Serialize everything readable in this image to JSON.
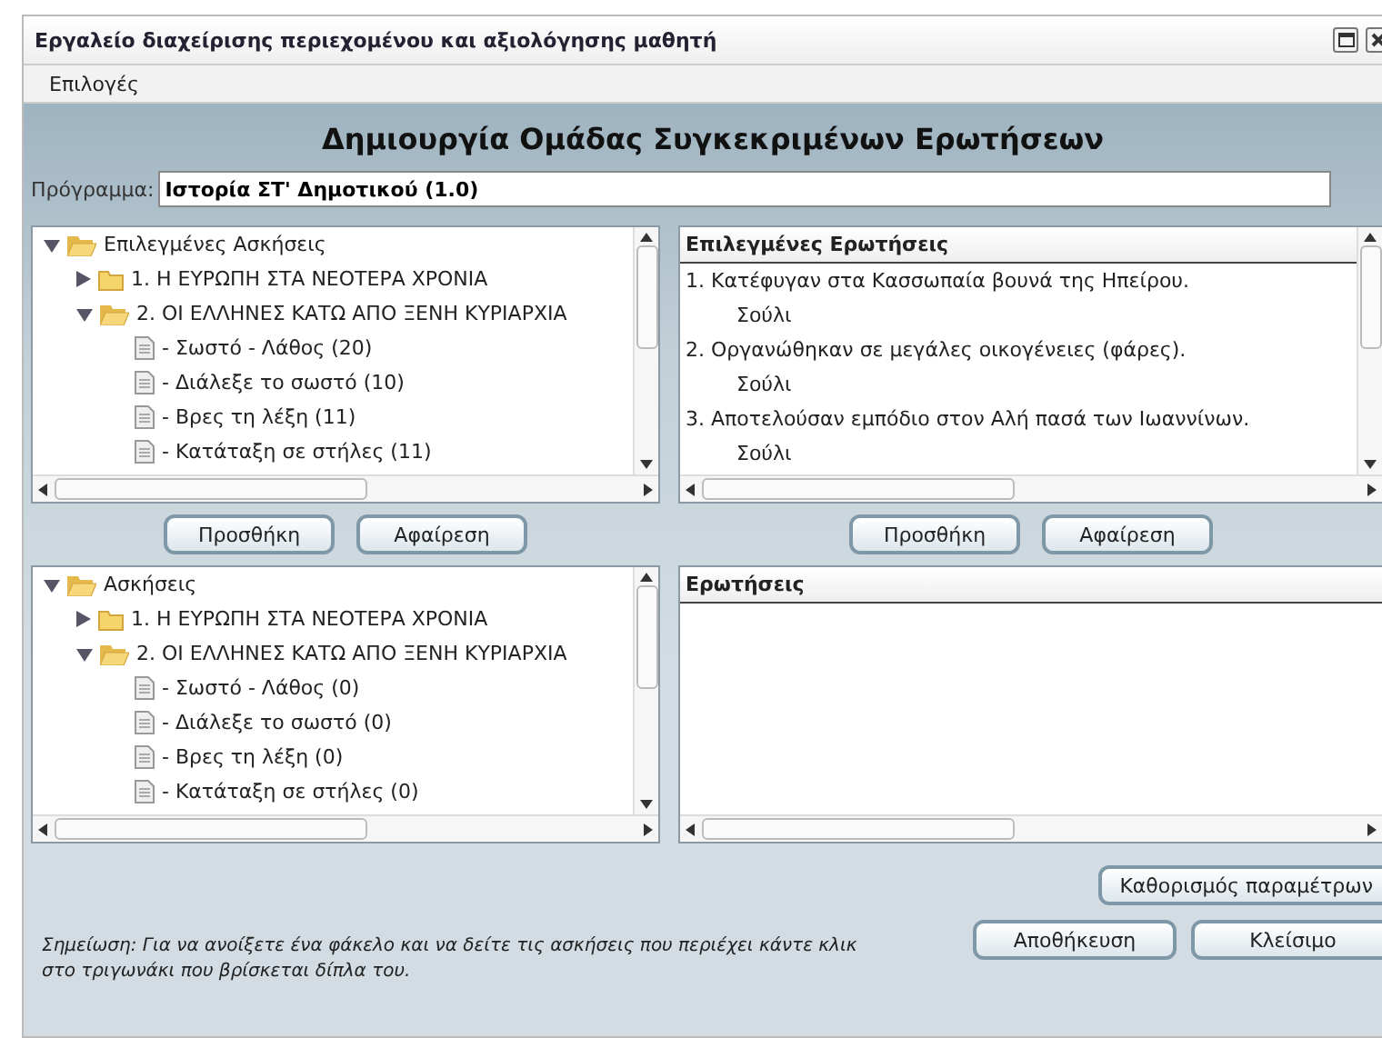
{
  "window": {
    "title": "Εργαλείο διαχείρισης περιεχομένου και αξιολόγησης μαθητή"
  },
  "menu": [
    "Επιλογές"
  ],
  "heading": "Δημιουργία Ομάδας Συγκεκριμένων Ερωτήσεων",
  "program": {
    "label": "Πρόγραμμα:",
    "value": "Ιστορία ΣΤ' Δημοτικού (1.0)"
  },
  "selected_exercises": {
    "tree": [
      {
        "label": "Επιλεγμένες Ασκήσεις",
        "kind": "folder",
        "expanded": true,
        "children": [
          {
            "label": "1.  Η ΕΥΡΩΠΗ ΣΤΑ ΝΕΟΤΕΡΑ ΧΡΟΝΙΑ",
            "kind": "folder",
            "expanded": false
          },
          {
            "label": "2.  ΟΙ ΕΛΛΗΝΕΣ ΚΑΤΩ ΑΠΟ ΞΕΝΗ ΚΥΡΙΑΡΧΙΑ",
            "kind": "folder",
            "expanded": true,
            "children": [
              {
                "label": "- Σωστό - Λάθος  (20)",
                "kind": "file"
              },
              {
                "label": "- Διάλεξε το σωστό  (10)",
                "kind": "file"
              },
              {
                "label": "- Βρες τη λέξη  (11)",
                "kind": "file"
              },
              {
                "label": "- Κατάταξη σε στήλες  (11)",
                "kind": "file"
              }
            ]
          }
        ]
      }
    ],
    "buttons": [
      "Προσθήκη",
      "Αφαίρεση"
    ]
  },
  "selected_questions": {
    "header": "Επιλεγμένες Ερωτήσεις",
    "items": [
      {
        "question": "1. Κατέφυγαν στα Κασσωπαία βουνά της Ηπείρου.",
        "answer": "Σούλι"
      },
      {
        "question": "2. Οργανώθηκαν σε μεγάλες οικογένειες (φάρες).",
        "answer": "Σούλι"
      },
      {
        "question": "3. Αποτελούσαν εμπόδιο στον Αλή πασά των Ιωαννίνων.",
        "answer": "Σούλι"
      }
    ],
    "buttons": [
      "Προσθήκη",
      "Αφαίρεση"
    ]
  },
  "exercises": {
    "tree": [
      {
        "label": "Ασκήσεις",
        "kind": "folder",
        "expanded": true,
        "children": [
          {
            "label": "1.  Η ΕΥΡΩΠΗ ΣΤΑ ΝΕΟΤΕΡΑ ΧΡΟΝΙΑ",
            "kind": "folder",
            "expanded": false
          },
          {
            "label": "2.  ΟΙ ΕΛΛΗΝΕΣ ΚΑΤΩ ΑΠΟ ΞΕΝΗ ΚΥΡΙΑΡΧΙΑ",
            "kind": "folder",
            "expanded": true,
            "children": [
              {
                "label": "- Σωστό - Λάθος  (0)",
                "kind": "file"
              },
              {
                "label": "- Διάλεξε το σωστό  (0)",
                "kind": "file"
              },
              {
                "label": "- Βρες τη λέξη  (0)",
                "kind": "file"
              },
              {
                "label": "- Κατάταξη σε στήλες  (0)",
                "kind": "file"
              }
            ]
          }
        ]
      }
    ]
  },
  "questions": {
    "header": "Ερωτήσεις"
  },
  "parameters_button": "Καθορισμός παραμέτρων",
  "note": "Σημείωση: Για να ανοίξετε ένα φάκελο και να δείτε τις ασκήσεις που περιέχει κάντε κλικ στο τριγωνάκι που βρίσκεται δίπλα του.",
  "footer_buttons": [
    "Αποθήκευση",
    "Κλείσιμο"
  ]
}
